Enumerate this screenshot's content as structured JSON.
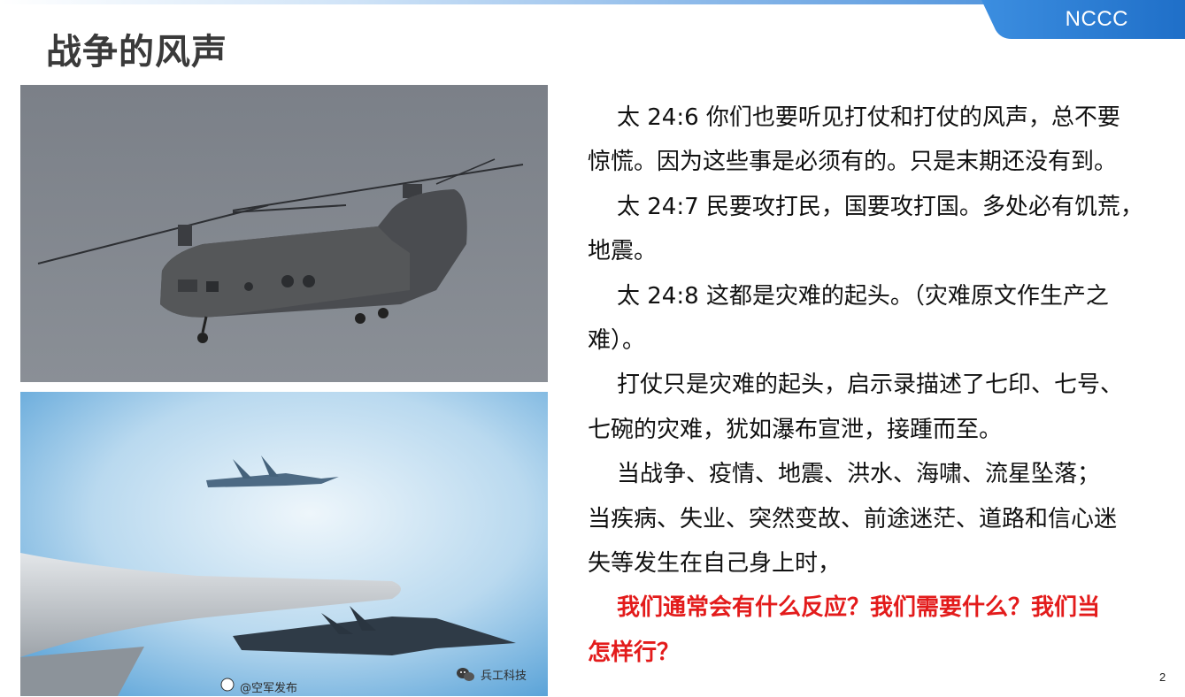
{
  "header": {
    "brand": "NCCC",
    "title": "战争的风声"
  },
  "images": {
    "top": "military-helicopter-photo",
    "bottom": "fighter-jets-photo",
    "watermark_left": "@空军发布",
    "watermark_right": "兵工科技"
  },
  "body": {
    "lines": [
      "太 24:6 你们也要听见打仗和打仗的风声，总不要",
      "惊慌。因为这些事是必须有的。只是末期还没有到。",
      "太 24:7 民要攻打民，国要攻打国。多处必有饥荒，",
      "地震。",
      "太 24:8 这都是灾难的起头。（灾难原文作生产之",
      "难）。",
      "打仗只是灾难的起头，启示录描述了七印、七号、",
      "七碗的灾难，犹如瀑布宣泄，接踵而至。",
      "当战争、疫情、地震、洪水、海啸、流星坠落；",
      "当疾病、失业、突然变故、前途迷茫、道路和信心迷",
      "失等发生在自己身上时，",
      "我们通常会有什么反应？我们需要什么？我们当",
      "怎样行？"
    ]
  },
  "footer": {
    "page_number": "2"
  },
  "colors": {
    "accent_blue": "#2f7fd6",
    "highlight_red": "#e31b1b",
    "title_gray": "#3a3a3a"
  }
}
